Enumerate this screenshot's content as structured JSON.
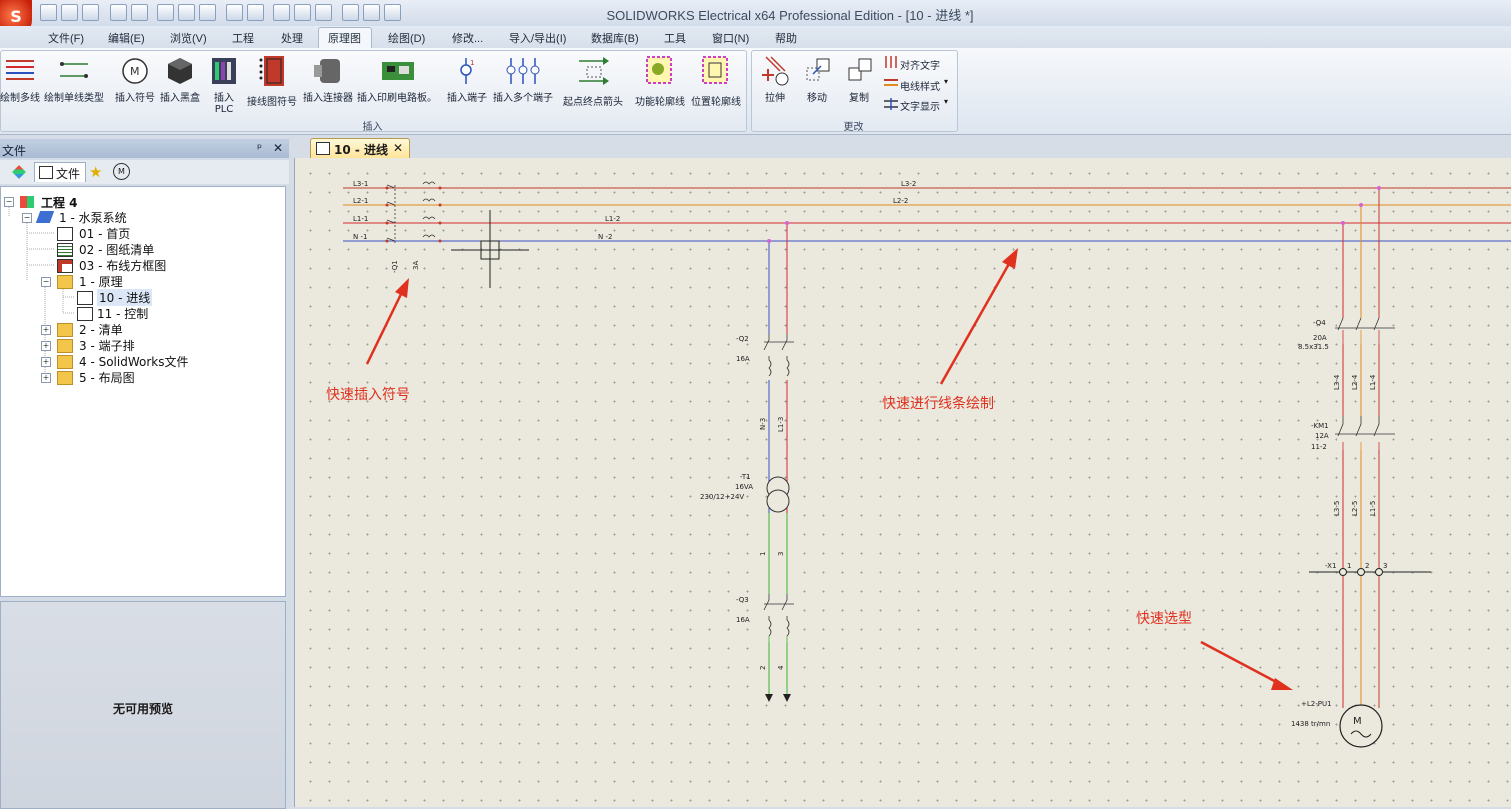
{
  "window": {
    "title": "SOLIDWORKS Electrical x64 Professional Edition - [10 - 进线 *]",
    "logo": "S"
  },
  "menus": [
    "文件(F)",
    "编辑(E)",
    "浏览(V)",
    "工程",
    "处理",
    "原理图",
    "绘图(D)",
    "修改...",
    "导入/导出(I)",
    "数据库(B)",
    "工具",
    "窗口(N)",
    "帮助"
  ],
  "ribbon": {
    "insert_group": "插入",
    "change_group": "更改",
    "buttons": {
      "draw_multi": "绘制多线",
      "draw_single": "绘制单线类型",
      "insert_symbol": "插入符号",
      "insert_blackbox": "插入黑盒",
      "insert_plc": "插入\nPLC",
      "connection_symbol": "接线图符号",
      "insert_connector": "插入连接器",
      "insert_pcb": "插入印刷电路板。",
      "insert_terminal": "插入端子",
      "insert_multi_terminal": "插入多个端子",
      "origin_arrow": "起点终点箭头",
      "function_outline": "功能轮廓线",
      "location_outline": "位置轮廓线",
      "stretch": "拉伸",
      "move": "移动",
      "copy": "复制",
      "align_text": "对齐文字",
      "wire_style": "电线样式",
      "text_display": "文字显示"
    }
  },
  "panel": {
    "title": "文件",
    "pin": "ᵖ",
    "close": "✕",
    "tab_files": "文件",
    "tree": {
      "root": "工程 4",
      "book": "1 - 水泵系统",
      "pages": [
        "01 - 首页",
        "02 - 图纸清单",
        "03 - 布线方框图"
      ],
      "folder_principle": "1 - 原理",
      "schematics": [
        "10 - 进线",
        "11 - 控制"
      ],
      "folders": [
        "2 - 清单",
        "3 - 端子排",
        "4 - SolidWorks文件",
        "5 - 布局图"
      ]
    },
    "preview": "无可用预览"
  },
  "document_tab": {
    "label": "10 - 进线",
    "close": "✕"
  },
  "annotations": {
    "insert_symbol": "快速插入符号",
    "draw_wire": "快速进行线条绘制",
    "quick_select": "快速选型"
  },
  "schematic": {
    "bus_left": [
      "L3-1",
      "L2-1",
      "L1-1",
      "N -1"
    ],
    "bus_mid": [
      "L3-2",
      "L2-2",
      "L1-2",
      "N -2"
    ],
    "q1": [
      "-Q1",
      "3A"
    ],
    "q2": [
      "-Q2",
      "16A"
    ],
    "t1": [
      "-T1",
      "16VA",
      "230/12+24V"
    ],
    "q3": [
      "-Q3",
      "16A"
    ],
    "q4": [
      "-Q4",
      "20A",
      "8.5x31.5"
    ],
    "km1": [
      "-KM1",
      "12A",
      "11-2"
    ],
    "x1": [
      "-X1",
      "1",
      "2",
      "3"
    ],
    "motor": [
      "+L2-PU1",
      "1438 tr/mn"
    ],
    "wire_tags": [
      "N-3",
      "L1-3",
      "1",
      "3",
      "2",
      "4",
      "L3-4",
      "L2-4",
      "L1-4",
      "L3-5",
      "L2-5",
      "L1-5"
    ]
  },
  "colors": {
    "l3": "#c0392b",
    "l2": "#e08a1e",
    "l1": "#d6282f",
    "n": "#3a4fc4",
    "low_voltage": "#3cb22e"
  }
}
